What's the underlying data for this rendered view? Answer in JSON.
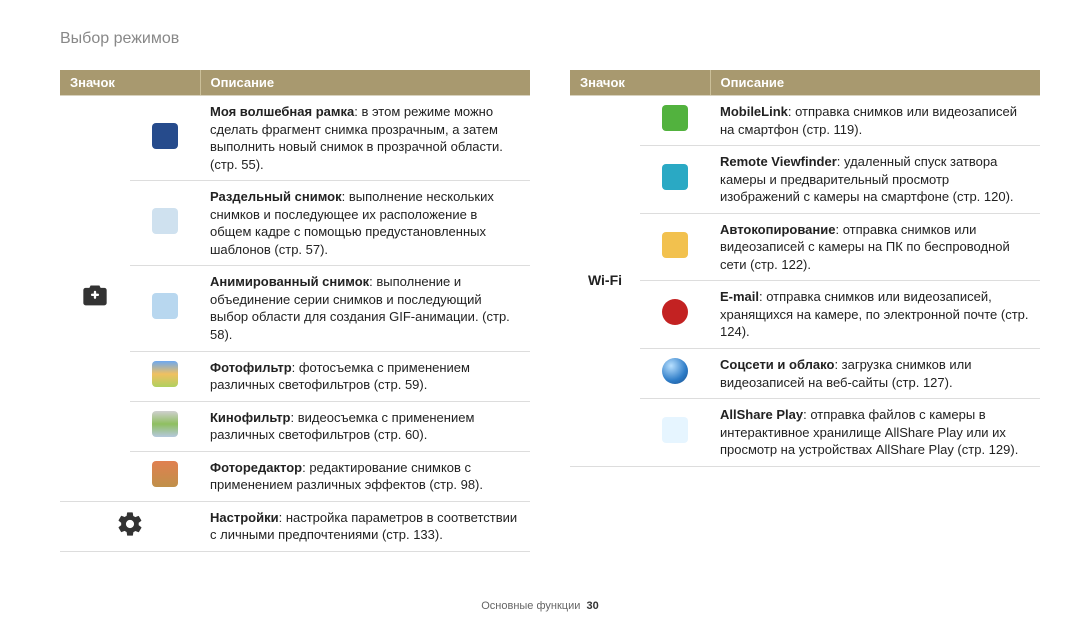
{
  "page_title": "Выбор режимов",
  "footer": {
    "section": "Основные функции",
    "page": "30"
  },
  "cols": {
    "left": {
      "head": {
        "icon": "Значок",
        "desc": "Описание"
      },
      "group": {
        "rows": [
          {
            "title": "Моя волшебная рамка",
            "rest": ": в этом режиме можно сделать фрагмент снимка прозрачным, а затем выполнить новый снимок в прозрачной области. (стр. 55)."
          },
          {
            "title": "Раздельный снимок",
            "rest": ": выполнение нескольких снимков и последующее их расположение в общем кадре с помощью предустановленных шаблонов (стр. 57)."
          },
          {
            "title": "Анимированный снимок",
            "rest": ": выполнение и объединение серии снимков и последующий выбор области для создания GIF-анимации. (стр. 58)."
          },
          {
            "title": "Фотофильтр",
            "rest": ": фотосъемка с применением различных светофильтров (стр. 59)."
          },
          {
            "title": "Кинофильтр",
            "rest": ": видеосъемка с применением различных светофильтров (стр. 60)."
          },
          {
            "title": "Фоторедактор",
            "rest": ": редактирование снимков с применением различных эффектов (стр. 98)."
          }
        ],
        "settings": {
          "title": "Настройки",
          "rest": ": настройка параметров в соответствии с личными предпочтениями (стр. 133)."
        }
      }
    },
    "right": {
      "head": {
        "icon": "Значок",
        "desc": "Описание"
      },
      "group_label": "Wi-Fi",
      "rows": [
        {
          "title": "MobileLink",
          "rest": ": отправка снимков или видеозаписей на смартфон (стр. 119)."
        },
        {
          "title": "Remote Viewfinder",
          "rest": ": удаленный спуск затвора камеры и предварительный просмотр изображений с камеры на смартфоне (стр. 120)."
        },
        {
          "title": "Автокопирование",
          "rest": ": отправка снимков или видеозаписей с камеры на ПК по беспроводной сети (стр. 122)."
        },
        {
          "title": "E-mail",
          "rest": ": отправка снимков или видеозаписей, хранящихся на камере, по электронной почте (стр. 124)."
        },
        {
          "title": "Соцсети и облако",
          "rest": ": загрузка снимков или видеозаписей на веб-сайты (стр. 127)."
        },
        {
          "title": "AllShare Play",
          "rest": ": отправка файлов с камеры в интерактивное хранилище AllShare Play или их просмотр на устройствах AllShare Play (стр. 129)."
        }
      ]
    }
  }
}
